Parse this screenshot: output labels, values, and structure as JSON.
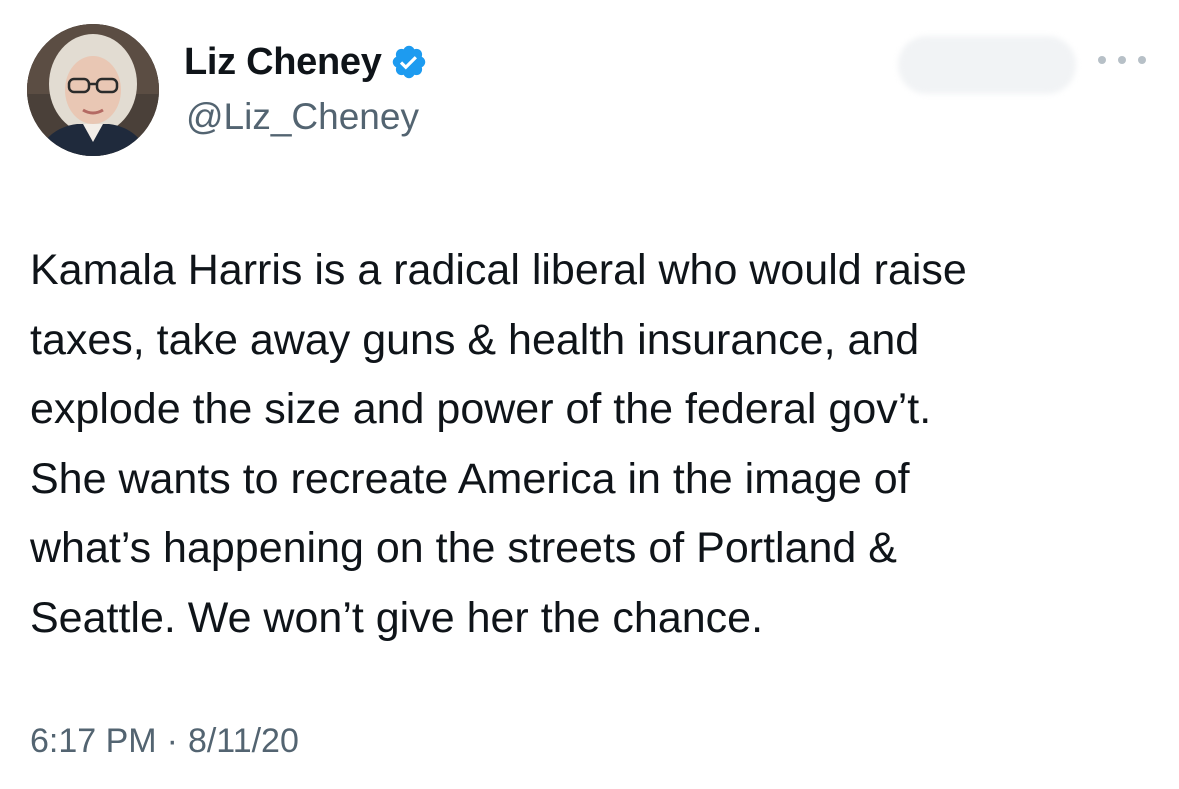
{
  "author": {
    "display_name": "Liz Cheney",
    "handle": "@Liz_Cheney",
    "verified": true,
    "verified_color": "#1d9bf0"
  },
  "header": {
    "more_icon": "more-horizontal-icon"
  },
  "tweet": {
    "text": "Kamala Harris is a radical liberal who would raise\ntaxes, take away guns & health insurance, and\nexplode the size and power of the federal gov’t.\nShe wants to recreate America in the image of\nwhat’s happening on the streets of Portland &\nSeattle. We won’t give her the chance.",
    "time": "6:17 PM",
    "separator": "·",
    "date": "8/11/20"
  },
  "colors": {
    "text_primary": "#0f1419",
    "text_secondary": "#536471",
    "background": "#ffffff"
  }
}
